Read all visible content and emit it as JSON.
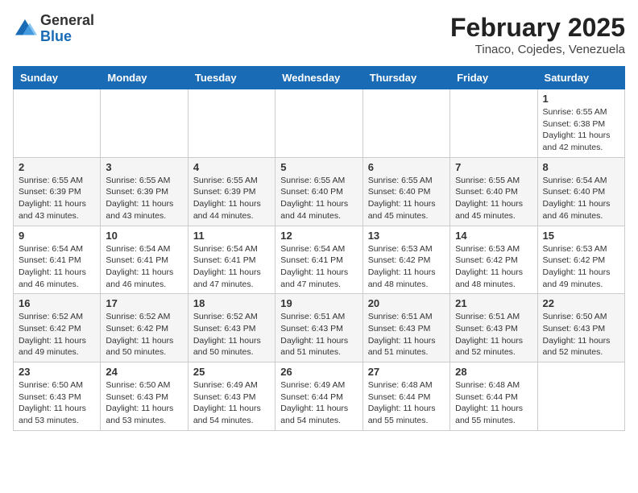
{
  "header": {
    "logo": {
      "general": "General",
      "blue": "Blue"
    },
    "title": "February 2025",
    "subtitle": "Tinaco, Cojedes, Venezuela"
  },
  "calendar": {
    "days_of_week": [
      "Sunday",
      "Monday",
      "Tuesday",
      "Wednesday",
      "Thursday",
      "Friday",
      "Saturday"
    ],
    "weeks": [
      [
        {
          "day": "",
          "info": ""
        },
        {
          "day": "",
          "info": ""
        },
        {
          "day": "",
          "info": ""
        },
        {
          "day": "",
          "info": ""
        },
        {
          "day": "",
          "info": ""
        },
        {
          "day": "",
          "info": ""
        },
        {
          "day": "1",
          "info": "Sunrise: 6:55 AM\nSunset: 6:38 PM\nDaylight: 11 hours\nand 42 minutes."
        }
      ],
      [
        {
          "day": "2",
          "info": "Sunrise: 6:55 AM\nSunset: 6:39 PM\nDaylight: 11 hours\nand 43 minutes."
        },
        {
          "day": "3",
          "info": "Sunrise: 6:55 AM\nSunset: 6:39 PM\nDaylight: 11 hours\nand 43 minutes."
        },
        {
          "day": "4",
          "info": "Sunrise: 6:55 AM\nSunset: 6:39 PM\nDaylight: 11 hours\nand 44 minutes."
        },
        {
          "day": "5",
          "info": "Sunrise: 6:55 AM\nSunset: 6:40 PM\nDaylight: 11 hours\nand 44 minutes."
        },
        {
          "day": "6",
          "info": "Sunrise: 6:55 AM\nSunset: 6:40 PM\nDaylight: 11 hours\nand 45 minutes."
        },
        {
          "day": "7",
          "info": "Sunrise: 6:55 AM\nSunset: 6:40 PM\nDaylight: 11 hours\nand 45 minutes."
        },
        {
          "day": "8",
          "info": "Sunrise: 6:54 AM\nSunset: 6:40 PM\nDaylight: 11 hours\nand 46 minutes."
        }
      ],
      [
        {
          "day": "9",
          "info": "Sunrise: 6:54 AM\nSunset: 6:41 PM\nDaylight: 11 hours\nand 46 minutes."
        },
        {
          "day": "10",
          "info": "Sunrise: 6:54 AM\nSunset: 6:41 PM\nDaylight: 11 hours\nand 46 minutes."
        },
        {
          "day": "11",
          "info": "Sunrise: 6:54 AM\nSunset: 6:41 PM\nDaylight: 11 hours\nand 47 minutes."
        },
        {
          "day": "12",
          "info": "Sunrise: 6:54 AM\nSunset: 6:41 PM\nDaylight: 11 hours\nand 47 minutes."
        },
        {
          "day": "13",
          "info": "Sunrise: 6:53 AM\nSunset: 6:42 PM\nDaylight: 11 hours\nand 48 minutes."
        },
        {
          "day": "14",
          "info": "Sunrise: 6:53 AM\nSunset: 6:42 PM\nDaylight: 11 hours\nand 48 minutes."
        },
        {
          "day": "15",
          "info": "Sunrise: 6:53 AM\nSunset: 6:42 PM\nDaylight: 11 hours\nand 49 minutes."
        }
      ],
      [
        {
          "day": "16",
          "info": "Sunrise: 6:52 AM\nSunset: 6:42 PM\nDaylight: 11 hours\nand 49 minutes."
        },
        {
          "day": "17",
          "info": "Sunrise: 6:52 AM\nSunset: 6:42 PM\nDaylight: 11 hours\nand 50 minutes."
        },
        {
          "day": "18",
          "info": "Sunrise: 6:52 AM\nSunset: 6:43 PM\nDaylight: 11 hours\nand 50 minutes."
        },
        {
          "day": "19",
          "info": "Sunrise: 6:51 AM\nSunset: 6:43 PM\nDaylight: 11 hours\nand 51 minutes."
        },
        {
          "day": "20",
          "info": "Sunrise: 6:51 AM\nSunset: 6:43 PM\nDaylight: 11 hours\nand 51 minutes."
        },
        {
          "day": "21",
          "info": "Sunrise: 6:51 AM\nSunset: 6:43 PM\nDaylight: 11 hours\nand 52 minutes."
        },
        {
          "day": "22",
          "info": "Sunrise: 6:50 AM\nSunset: 6:43 PM\nDaylight: 11 hours\nand 52 minutes."
        }
      ],
      [
        {
          "day": "23",
          "info": "Sunrise: 6:50 AM\nSunset: 6:43 PM\nDaylight: 11 hours\nand 53 minutes."
        },
        {
          "day": "24",
          "info": "Sunrise: 6:50 AM\nSunset: 6:43 PM\nDaylight: 11 hours\nand 53 minutes."
        },
        {
          "day": "25",
          "info": "Sunrise: 6:49 AM\nSunset: 6:43 PM\nDaylight: 11 hours\nand 54 minutes."
        },
        {
          "day": "26",
          "info": "Sunrise: 6:49 AM\nSunset: 6:44 PM\nDaylight: 11 hours\nand 54 minutes."
        },
        {
          "day": "27",
          "info": "Sunrise: 6:48 AM\nSunset: 6:44 PM\nDaylight: 11 hours\nand 55 minutes."
        },
        {
          "day": "28",
          "info": "Sunrise: 6:48 AM\nSunset: 6:44 PM\nDaylight: 11 hours\nand 55 minutes."
        },
        {
          "day": "",
          "info": ""
        }
      ]
    ]
  }
}
